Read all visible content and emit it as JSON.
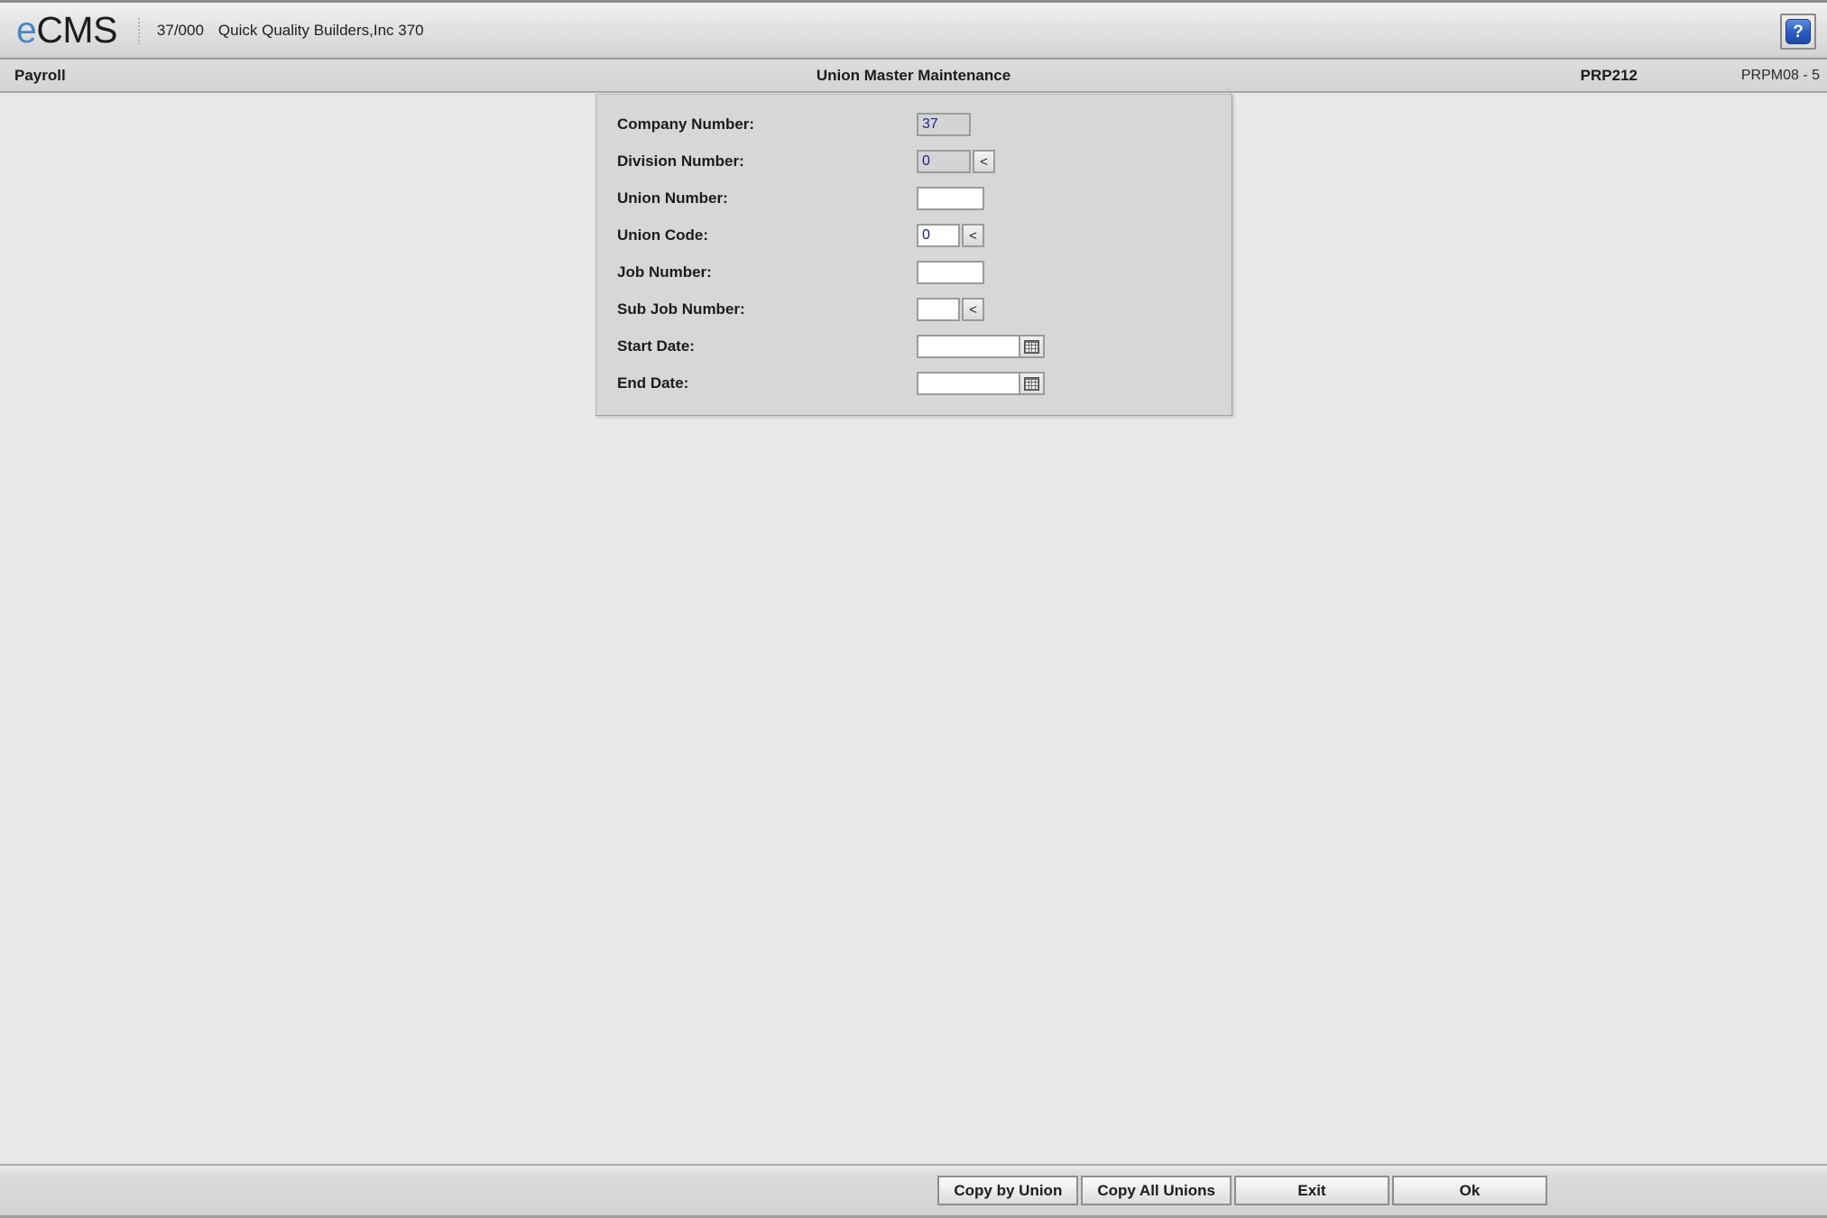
{
  "topbar": {
    "logo_e": "e",
    "logo_cms": "CMS",
    "company_id": "37/000",
    "company_name": "Quick Quality Builders,Inc 370",
    "help_label": "?",
    "help_icon": "help-question-icon"
  },
  "subheader": {
    "module": "Payroll",
    "title": "Union Master Maintenance",
    "program_id": "PRP212",
    "screen_id": "PRPM08 - 5"
  },
  "form": {
    "fields": [
      {
        "label": "Company Number:",
        "name": "company-number",
        "value": "37",
        "placeholder": "",
        "width": "w-med",
        "disabled": true,
        "lookup": false,
        "calendar": false
      },
      {
        "label": "Division Number:",
        "name": "division-number",
        "value": "0",
        "placeholder": "",
        "width": "w-med",
        "disabled": true,
        "lookup": true,
        "calendar": false
      },
      {
        "label": "Union Number:",
        "name": "union-number",
        "value": "",
        "placeholder": "",
        "width": "w-wide",
        "disabled": false,
        "lookup": false,
        "calendar": false
      },
      {
        "label": "Union Code:",
        "name": "union-code",
        "value": "0",
        "placeholder": "",
        "width": "w-small",
        "disabled": false,
        "lookup": true,
        "calendar": false
      },
      {
        "label": "Job Number:",
        "name": "job-number",
        "value": "",
        "placeholder": "",
        "width": "w-wide",
        "disabled": false,
        "lookup": false,
        "calendar": false
      },
      {
        "label": "Sub Job Number:",
        "name": "sub-job-number",
        "value": "",
        "placeholder": "",
        "width": "w-small",
        "disabled": false,
        "lookup": true,
        "calendar": false
      },
      {
        "label": "Start Date:",
        "name": "start-date",
        "value": "",
        "placeholder": "",
        "width": "w-date",
        "disabled": false,
        "lookup": false,
        "calendar": true
      },
      {
        "label": "End Date:",
        "name": "end-date",
        "value": "",
        "placeholder": "",
        "width": "w-date",
        "disabled": false,
        "lookup": false,
        "calendar": true
      }
    ],
    "lookup_glyph": "<",
    "calendar_icon": "calendar-icon"
  },
  "footer": {
    "buttons": [
      {
        "label": "Copy by Union",
        "name": "copy-by-union-button",
        "size": ""
      },
      {
        "label": "Copy All Unions",
        "name": "copy-all-unions-button",
        "size": ""
      },
      {
        "label": "Exit",
        "name": "exit-button",
        "size": "w-exit"
      },
      {
        "label": "Ok",
        "name": "ok-button",
        "size": "w-ok"
      }
    ]
  },
  "colors": {
    "page_background": "#e8e8e8",
    "panel_background": "#d7d7d7",
    "brand_blue": "#4a87c4",
    "value_text": "#1a1a6e",
    "help_blue": "#2f5fc4"
  }
}
